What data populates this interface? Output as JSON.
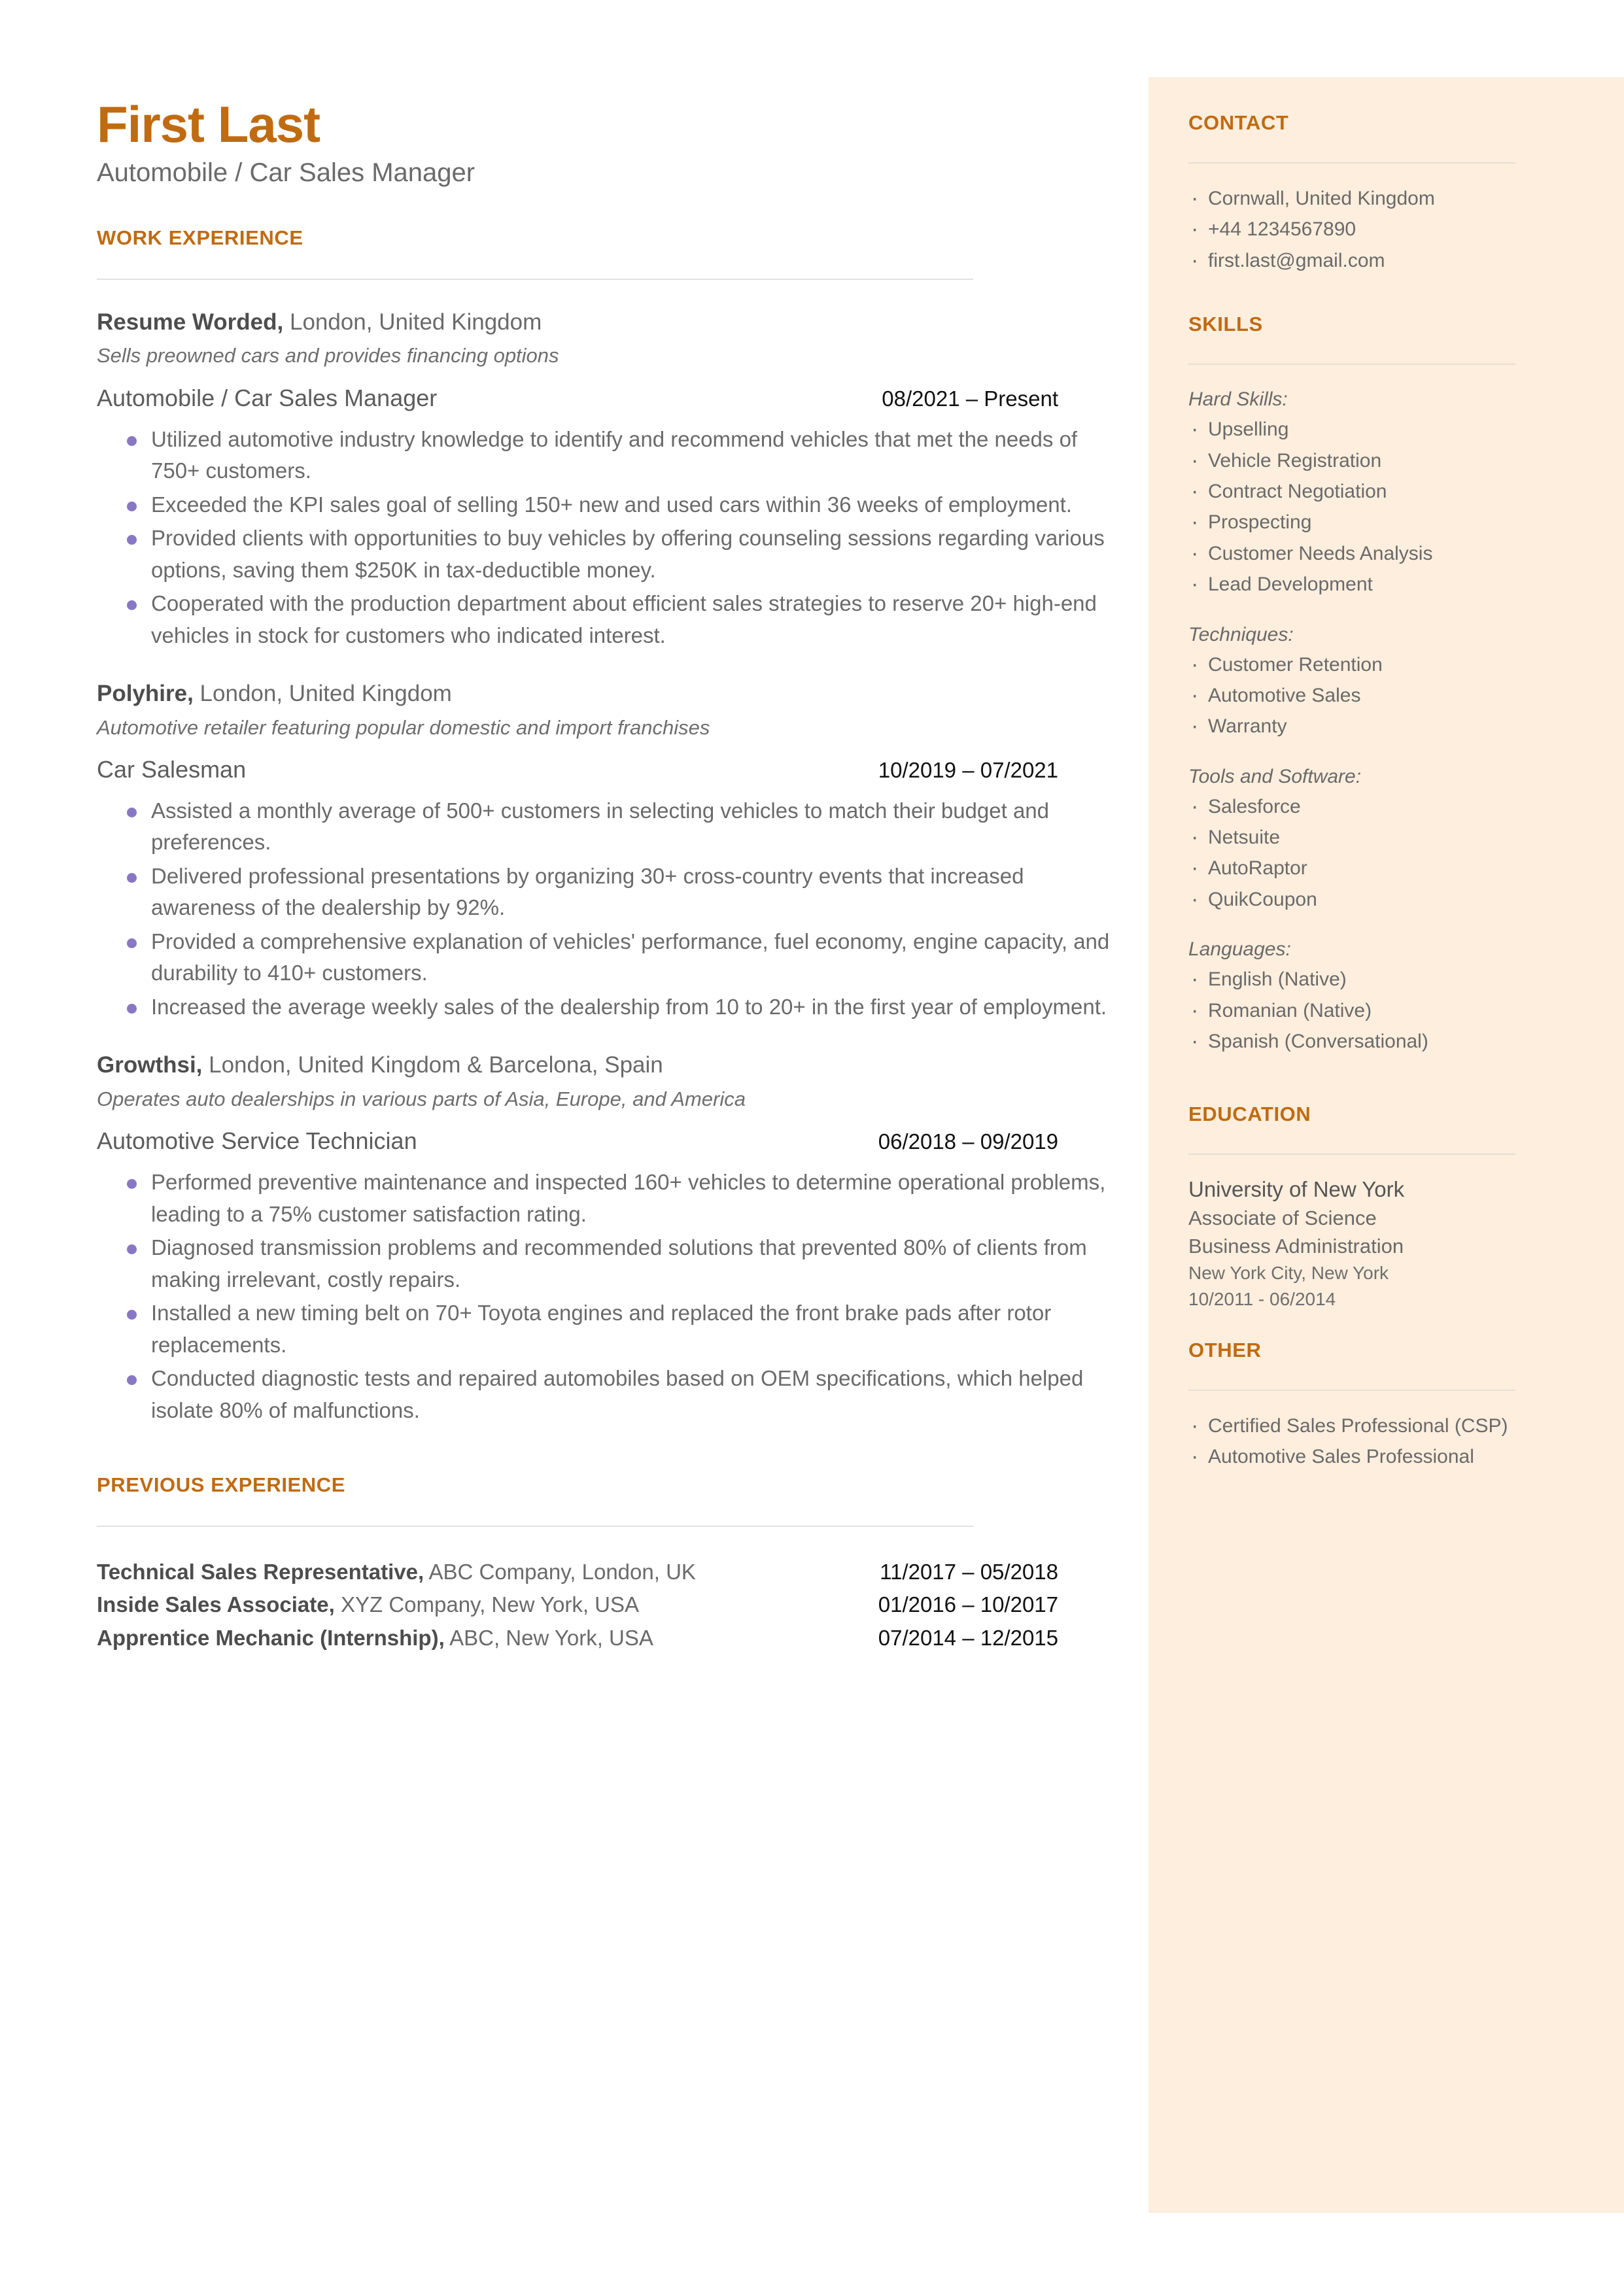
{
  "theme": {
    "accent": "#c06b11",
    "sidebar_bg": "#fdeedd",
    "bullet": "#8878c3",
    "body_text": "#6a6a6a",
    "date_text": "#111111"
  },
  "header": {
    "name": "First Last",
    "headline": "Automobile / Car Sales Manager"
  },
  "work_experience": {
    "section_title": "WORK EXPERIENCE",
    "jobs": [
      {
        "company": "Resume Worded,",
        "location": " London, United Kingdom",
        "description": "Sells preowned cars and provides financing options",
        "title": "Automobile / Car Sales Manager",
        "dates": "08/2021 – Present",
        "bullets": [
          "Utilized automotive industry knowledge to identify and recommend vehicles that met the needs of 750+ customers.",
          "Exceeded the KPI sales goal of selling 150+ new and used cars within 36 weeks of employment.",
          "Provided clients with opportunities to buy vehicles by offering counseling sessions regarding various options, saving them $250K in tax-deductible money.",
          "Cooperated with the production department about efficient sales strategies to reserve 20+ high-end vehicles in stock for customers who indicated interest."
        ]
      },
      {
        "company": "Polyhire,",
        "location": " London, United Kingdom",
        "description": "Automotive retailer featuring popular domestic and import franchises",
        "title": "Car Salesman",
        "dates": "10/2019 – 07/2021",
        "bullets": [
          "Assisted a monthly average of 500+ customers in selecting vehicles to match their budget and preferences.",
          "Delivered professional presentations by organizing 30+ cross-country events that increased awareness of the dealership by 92%.",
          "Provided a comprehensive explanation of vehicles' performance, fuel economy, engine capacity, and durability to 410+ customers.",
          "Increased the average weekly sales of the dealership from 10 to 20+ in the first year of employment."
        ]
      },
      {
        "company": "Growthsi,",
        "location": " London, United Kingdom & Barcelona, Spain",
        "description": "Operates auto dealerships in various parts of Asia, Europe, and America",
        "title": "Automotive Service Technician",
        "dates": "06/2018 – 09/2019",
        "bullets": [
          "Performed preventive maintenance and inspected 160+ vehicles to determine operational problems, leading to a 75% customer satisfaction rating.",
          "Diagnosed transmission problems and recommended solutions that prevented 80% of clients from making irrelevant, costly repairs.",
          "Installed a new timing belt on 70+ Toyota engines and replaced the front brake pads after rotor replacements.",
          "Conducted diagnostic tests and repaired automobiles based on OEM specifications, which helped isolate 80% of malfunctions."
        ]
      }
    ]
  },
  "previous_experience": {
    "section_title": "PREVIOUS EXPERIENCE",
    "rows": [
      {
        "title": "Technical Sales Representative,",
        "detail": " ABC Company, London, UK",
        "dates": "11/2017 – 05/2018"
      },
      {
        "title": "Inside Sales Associate,",
        "detail": " XYZ Company, New York, USA",
        "dates": "01/2016 – 10/2017"
      },
      {
        "title": "Apprentice Mechanic (Internship),",
        "detail": " ABC, New York, USA",
        "dates": "07/2014 – 12/2015"
      }
    ]
  },
  "sidebar": {
    "contact": {
      "title": "CONTACT",
      "items": [
        "Cornwall, United Kingdom",
        "+44 1234567890",
        "first.last@gmail.com"
      ]
    },
    "skills": {
      "title": "SKILLS",
      "groups": [
        {
          "label": "Hard Skills:",
          "items": [
            "Upselling",
            "Vehicle Registration",
            "Contract Negotiation",
            "Prospecting",
            "Customer Needs Analysis",
            "Lead Development"
          ]
        },
        {
          "label": "Techniques:",
          "items": [
            "Customer Retention",
            "Automotive Sales",
            "Warranty"
          ]
        },
        {
          "label": "Tools and Software:",
          "items": [
            "Salesforce",
            "Netsuite",
            "AutoRaptor",
            "QuikCoupon"
          ]
        },
        {
          "label": "Languages:",
          "items": [
            "English (Native)",
            "Romanian (Native)",
            "Spanish (Conversational)"
          ]
        }
      ]
    },
    "education": {
      "title": "EDUCATION",
      "school": "University of New York",
      "degree": "Associate of Science",
      "field": "Business Administration",
      "location": "New York City, New York",
      "dates": "10/2011 - 06/2014"
    },
    "other": {
      "title": "OTHER",
      "items": [
        "Certified Sales Professional (CSP)",
        "Automotive Sales Professional"
      ]
    }
  }
}
